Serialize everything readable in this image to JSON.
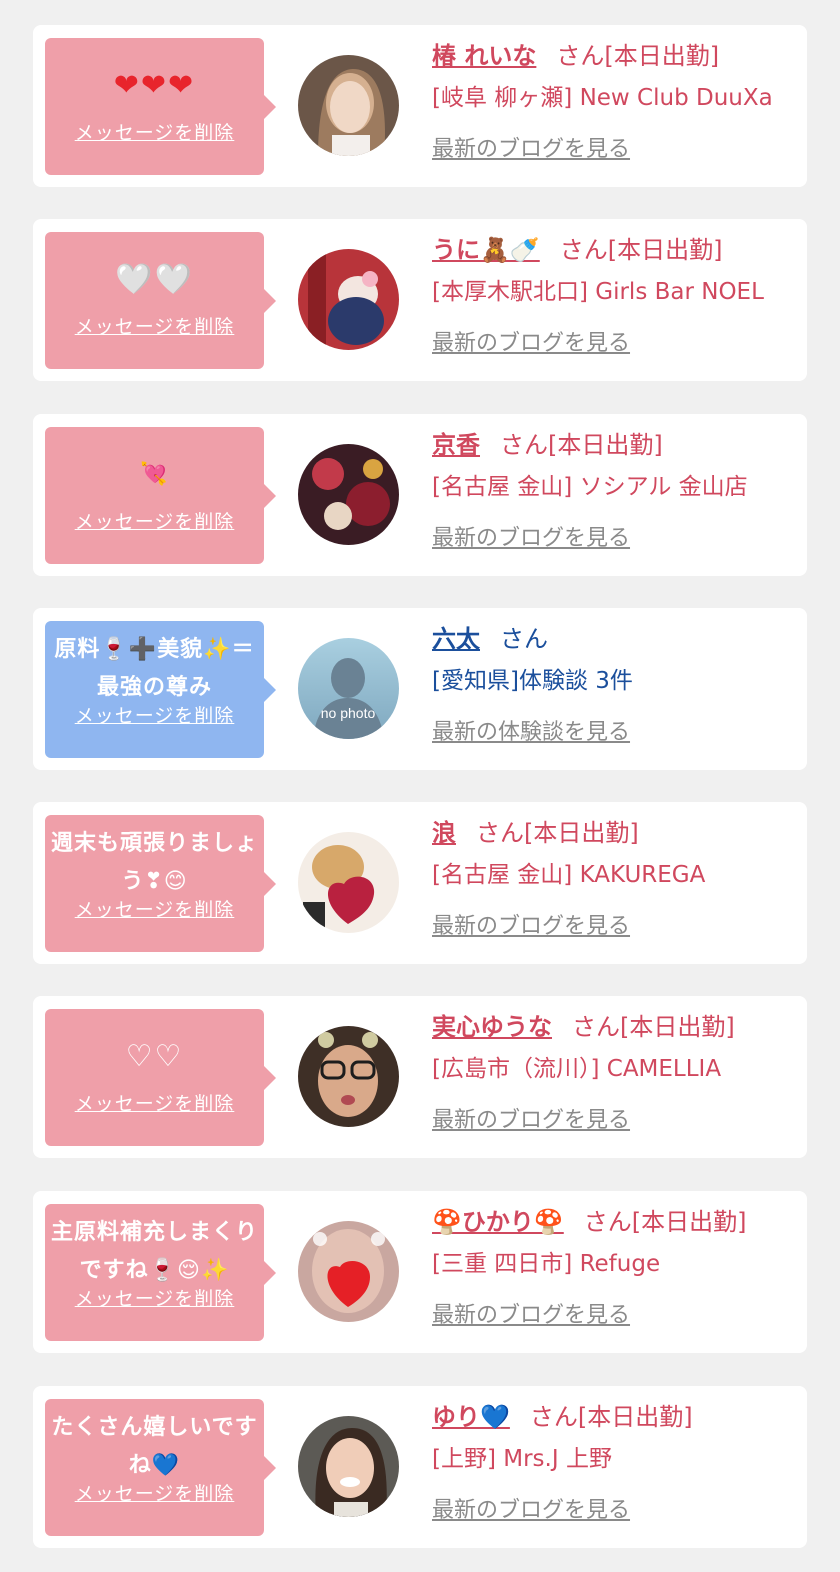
{
  "cards": [
    {
      "message": "❤❤❤",
      "delete_label": "メッセージを削除",
      "name": "椿 れいな",
      "suffix": "さん[本日出勤]",
      "shop": "[岐阜 柳ヶ瀬] New Club DuuXa",
      "blog": "最新のブログを見る"
    },
    {
      "message": "🤍🤍",
      "delete_label": "メッセージを削除",
      "name": "うに🧸🍼",
      "suffix": "さん[本日出勤]",
      "shop": "[本厚木駅北口] Girls Bar NOEL",
      "blog": "最新のブログを見る"
    },
    {
      "message": "💘",
      "delete_label": "メッセージを削除",
      "name": "京香",
      "suffix": "さん[本日出勤]",
      "shop": "[名古屋 金山] ソシアル 金山店",
      "blog": "最新のブログを見る"
    },
    {
      "message": "原料🍷➕美貌✨＝最強の尊み",
      "delete_label": "メッセージを削除",
      "name": "六太",
      "suffix": "さん",
      "shop": "[愛知県]体験談 3件",
      "blog": "最新の体験談を見る",
      "avatar_text": "no photo"
    },
    {
      "message": "週末も頑張りましょう❣😊",
      "delete_label": "メッセージを削除",
      "name": "浪",
      "suffix": "さん[本日出勤]",
      "shop": "[名古屋 金山] KAKUREGA",
      "blog": "最新のブログを見る"
    },
    {
      "message": "♡♡",
      "delete_label": "メッセージを削除",
      "name": "実心ゆうな",
      "suffix": "さん[本日出勤]",
      "shop": "[広島市（流川）] CAMELLIA",
      "blog": "最新のブログを見る"
    },
    {
      "message": "主原料補充しまくりですね🍷😌✨",
      "delete_label": "メッセージを削除",
      "name": "🍄ひかり🍄",
      "suffix": "さん[本日出勤]",
      "shop": "[三重 四日市] Refuge",
      "blog": "最新のブログを見る"
    },
    {
      "message": "たくさん嬉しいですね💙",
      "delete_label": "メッセージを削除",
      "name": "ゆり💙",
      "suffix": "さん[本日出勤]",
      "shop": "[上野] Mrs.J 上野",
      "blog": "最新のブログを見る"
    }
  ],
  "colors": {
    "bubble_pink": "#ef9fa9",
    "bubble_blue": "#8fb6f0",
    "name_pink": "#d0485e",
    "name_blue": "#1b4f9c",
    "link_gray": "#8a8a8a"
  }
}
